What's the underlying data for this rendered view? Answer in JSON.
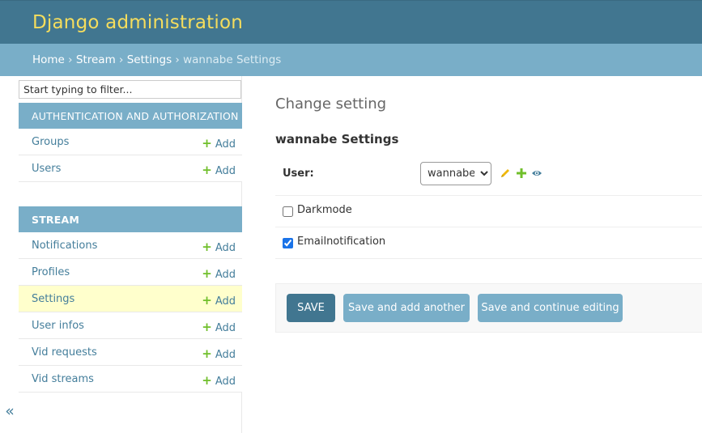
{
  "header": {
    "site_name": "Django administration"
  },
  "breadcrumbs": {
    "home": "Home",
    "app": "Stream",
    "model": "Settings",
    "current": "wannabe Settings",
    "separator": "›"
  },
  "sidebar": {
    "filter_placeholder": "Start typing to filter...",
    "auth_module": {
      "caption": "AUTHENTICATION AND AUTHORIZATION",
      "models": [
        {
          "label": "Groups",
          "add": "Add"
        },
        {
          "label": "Users",
          "add": "Add"
        }
      ]
    },
    "stream_module": {
      "caption": "STREAM",
      "models": [
        {
          "label": "Notifications",
          "add": "Add"
        },
        {
          "label": "Profiles",
          "add": "Add"
        },
        {
          "label": "Settings",
          "add": "Add",
          "selected": true
        },
        {
          "label": "User infos",
          "add": "Add"
        },
        {
          "label": "Vid requests",
          "add": "Add"
        },
        {
          "label": "Vid streams",
          "add": "Add"
        }
      ]
    },
    "toggle_label": "«"
  },
  "content": {
    "title": "Change setting",
    "object_title": "wannabe Settings",
    "fields": {
      "user": {
        "label": "User:",
        "value": "wannabe",
        "options": [
          "wannabe"
        ]
      },
      "darkmode": {
        "label": "Darkmode",
        "checked": false
      },
      "emailnotification": {
        "label": "Emailnotification",
        "checked": true
      }
    },
    "icons": {
      "edit": "pencil-icon",
      "add": "plus-icon",
      "view": "eye-icon"
    }
  },
  "submit": {
    "save": "SAVE",
    "save_add": "Save and add another",
    "save_continue": "Save and continue editing"
  },
  "colors": {
    "header_bg": "#417690",
    "site_name": "#f5dd5d",
    "breadcrumbs_bg": "#79aec8",
    "link": "#447e9b",
    "add_plus": "#70bf2b",
    "selected_row": "#ffffcc",
    "primary_button": "#417690",
    "secondary_button": "#79aec8"
  }
}
